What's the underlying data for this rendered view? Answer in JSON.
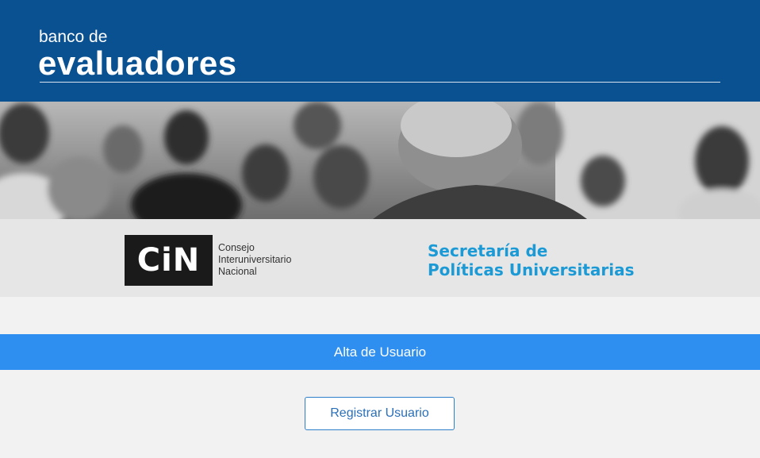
{
  "header": {
    "subtitle": "banco de",
    "title": "evaluadores"
  },
  "banner": {
    "photo_description_icon": "classroom-photo"
  },
  "logos": {
    "cin": {
      "mark": "CiN",
      "lines": [
        "Consejo",
        "Interuniversitario",
        "Nacional"
      ]
    },
    "spu": {
      "lines": [
        "Secretaría de",
        "Políticas Universitarias"
      ]
    }
  },
  "section": {
    "title": "Alta de Usuario"
  },
  "actions": {
    "register_label": "Registrar Usuario"
  },
  "colors": {
    "header_bg": "#0a5192",
    "band_bg": "#2e8ff0",
    "spu_text": "#1b9ad6",
    "button_text": "#2a6fb8"
  }
}
